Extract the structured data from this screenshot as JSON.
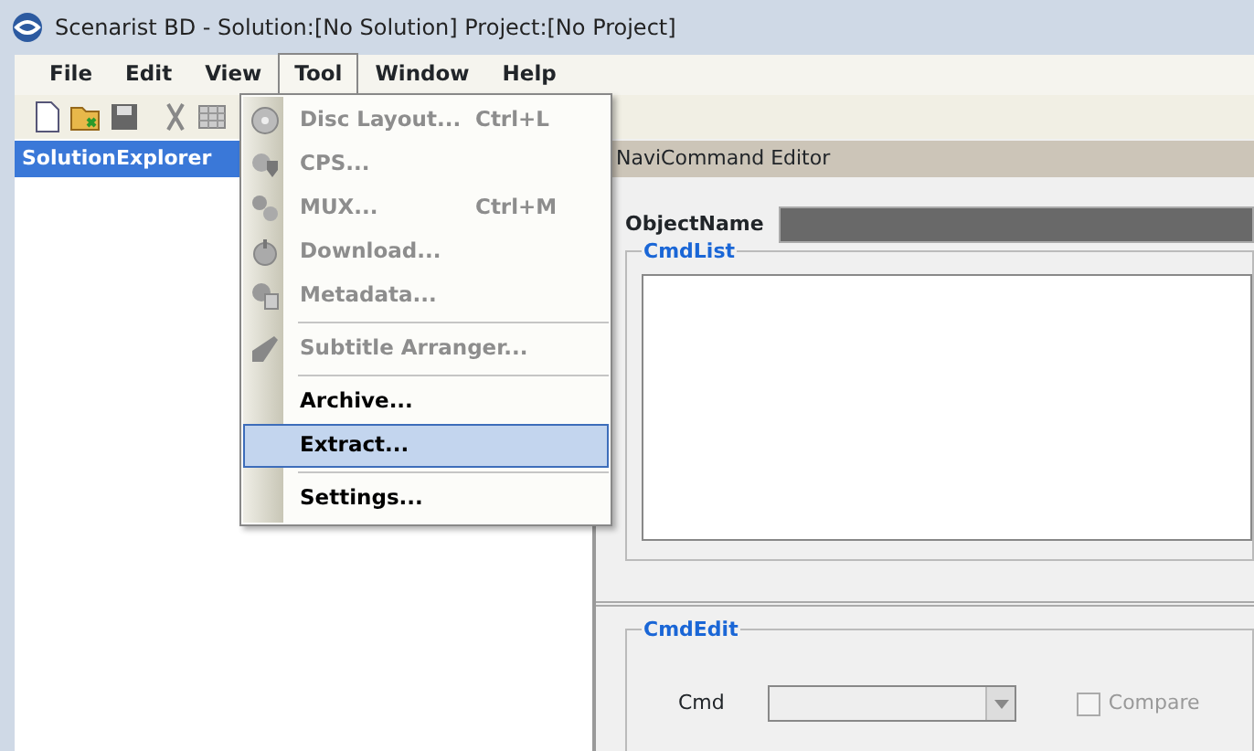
{
  "window": {
    "title": "Scenarist BD - Solution:[No Solution] Project:[No Project]"
  },
  "menubar": [
    {
      "label": "File",
      "selected": false
    },
    {
      "label": "Edit",
      "selected": false
    },
    {
      "label": "View",
      "selected": false
    },
    {
      "label": "Tool",
      "selected": true
    },
    {
      "label": "Window",
      "selected": false
    },
    {
      "label": "Help",
      "selected": false
    }
  ],
  "tool_menu": [
    {
      "kind": "item",
      "label": "Disc Layout...",
      "shortcut": "Ctrl+L",
      "disabled": true,
      "selected": false
    },
    {
      "kind": "item",
      "label": "CPS...",
      "disabled": true,
      "selected": false
    },
    {
      "kind": "item",
      "label": "MUX...",
      "shortcut": "Ctrl+M",
      "disabled": true,
      "selected": false
    },
    {
      "kind": "item",
      "label": "Download...",
      "disabled": true,
      "selected": false
    },
    {
      "kind": "item",
      "label": "Metadata...",
      "disabled": true,
      "selected": false
    },
    {
      "kind": "separator"
    },
    {
      "kind": "item",
      "label": "Subtitle Arranger...",
      "disabled": true,
      "selected": false
    },
    {
      "kind": "separator"
    },
    {
      "kind": "item",
      "label": "Archive...",
      "disabled": false,
      "selected": false
    },
    {
      "kind": "item",
      "label": "Extract...",
      "disabled": false,
      "selected": true
    },
    {
      "kind": "separator"
    },
    {
      "kind": "item",
      "label": "Settings...",
      "disabled": false,
      "selected": false
    }
  ],
  "solution_explorer": {
    "title": "SolutionExplorer"
  },
  "editor": {
    "title": "NaviCommand Editor",
    "object_name_label": "ObjectName",
    "cmdlist": {
      "title": "CmdList"
    },
    "cmdedit": {
      "title": "CmdEdit",
      "cmd_label": "Cmd",
      "cmd_disabled": true,
      "compare": {
        "label": "Compare",
        "checked": false,
        "disabled": true
      }
    }
  }
}
